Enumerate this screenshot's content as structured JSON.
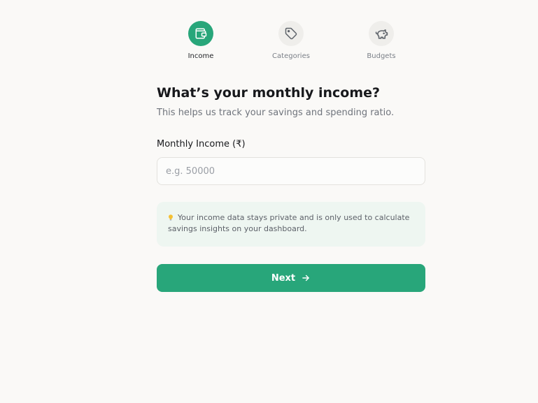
{
  "steps": [
    {
      "label": "Income",
      "icon": "wallet-icon",
      "active": true
    },
    {
      "label": "Categories",
      "icon": "tag-icon",
      "active": false
    },
    {
      "label": "Budgets",
      "icon": "piggy-bank-icon",
      "active": false
    }
  ],
  "form": {
    "heading": "What’s your monthly income?",
    "subheading": "This helps us track your savings and spending ratio.",
    "income_label": "Monthly Income (₹)",
    "income_placeholder": "e.g. 50000",
    "income_value": "",
    "info_text": "Your income data stays private and is only used to calculate savings insights on your dashboard.",
    "info_icon": "lightbulb-icon",
    "next_label": "Next",
    "next_icon": "arrow-right-icon"
  },
  "colors": {
    "accent": "#28a67a",
    "background": "#faf9f7",
    "info_background": "#eef6f1"
  }
}
